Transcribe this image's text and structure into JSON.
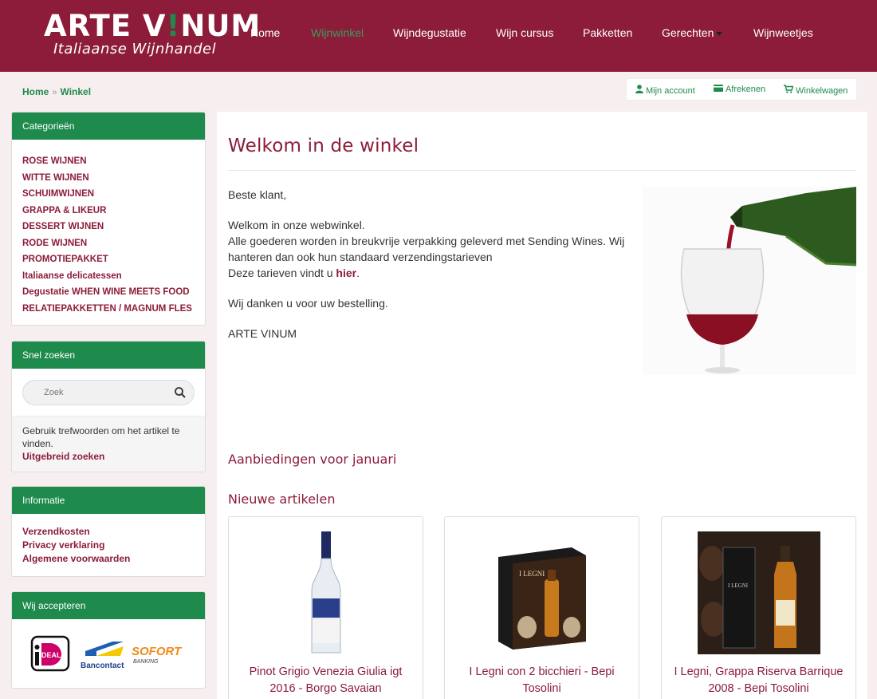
{
  "brand": {
    "name": "ARTE VINUM",
    "name_pre": "ARTE V",
    "name_mark": "!",
    "name_post": "NUM",
    "tagline": "Italiaanse Wijnhandel"
  },
  "nav": {
    "items": [
      {
        "label": "Home"
      },
      {
        "label": "Wijnwinkel",
        "active": true
      },
      {
        "label": "Wijndegustatie"
      },
      {
        "label": "Wijn cursus"
      },
      {
        "label": "Pakketten"
      },
      {
        "label": "Gerechten",
        "dropdown": true
      },
      {
        "label": "Wijnweetjes"
      }
    ]
  },
  "breadcrumb": {
    "home": "Home",
    "separator": "»",
    "current": "Winkel"
  },
  "account": {
    "my_account": "Mijn account",
    "checkout": "Afrekenen",
    "cart": "Winkelwagen"
  },
  "sidebar": {
    "categories": {
      "title": "Categorieën",
      "items": [
        "ROSE WIJNEN",
        "WITTE WIJNEN",
        "SCHUIMWIJNEN",
        "GRAPPA & LIKEUR",
        "DESSERT WIJNEN",
        "RODE WIJNEN",
        "PROMOTIEPAKKET",
        "Italiaanse delicatessen",
        "Degustatie WHEN WINE MEETS FOOD",
        "RELATIEPAKKETTEN / MAGNUM FLES"
      ]
    },
    "search": {
      "title": "Snel zoeken",
      "placeholder": "Zoek",
      "help": "Gebruik trefwoorden om het artikel te vinden.",
      "advanced": "Uitgebreid zoeken"
    },
    "info": {
      "title": "Informatie",
      "items": [
        "Verzendkosten",
        "Privacy verklaring",
        "Algemene voorwaarden"
      ]
    },
    "payments": {
      "title": "Wij accepteren",
      "ideal_label": "iDEAL",
      "bancontact_label": "Bancontact",
      "sofort_label": "SOFORT",
      "sofort_sub": "BANKING"
    }
  },
  "main": {
    "title": "Welkom in de winkel",
    "greeting": "Beste klant,",
    "p1_line1": "Welkom in onze webwinkel.",
    "p1_line2": "Alle goederen worden in breukvrije verpakking geleverd met Sending Wines. Wij hanteren dan ook hun standaard verzendingstarieven",
    "p1_line3_pre": "Deze tarieven vindt u ",
    "p1_link": "hier",
    "p1_line3_post": ".",
    "thanks": "Wij danken u voor uw bestelling.",
    "signature": "ARTE VINUM",
    "offers_title": "Aanbiedingen voor januari",
    "new_title": "Nieuwe artikelen",
    "products": [
      {
        "name": "Pinot Grigio Venezia Giulia igt 2016 - Borgo Savaian"
      },
      {
        "name": "I Legni con 2 bicchieri - Bepi Tosolini"
      },
      {
        "name": "I Legni, Grappa Riserva Barrique 2008 - Bepi Tosolini"
      }
    ]
  },
  "colors": {
    "brand": "#8c1c3a",
    "accent": "#1e8a4c"
  }
}
